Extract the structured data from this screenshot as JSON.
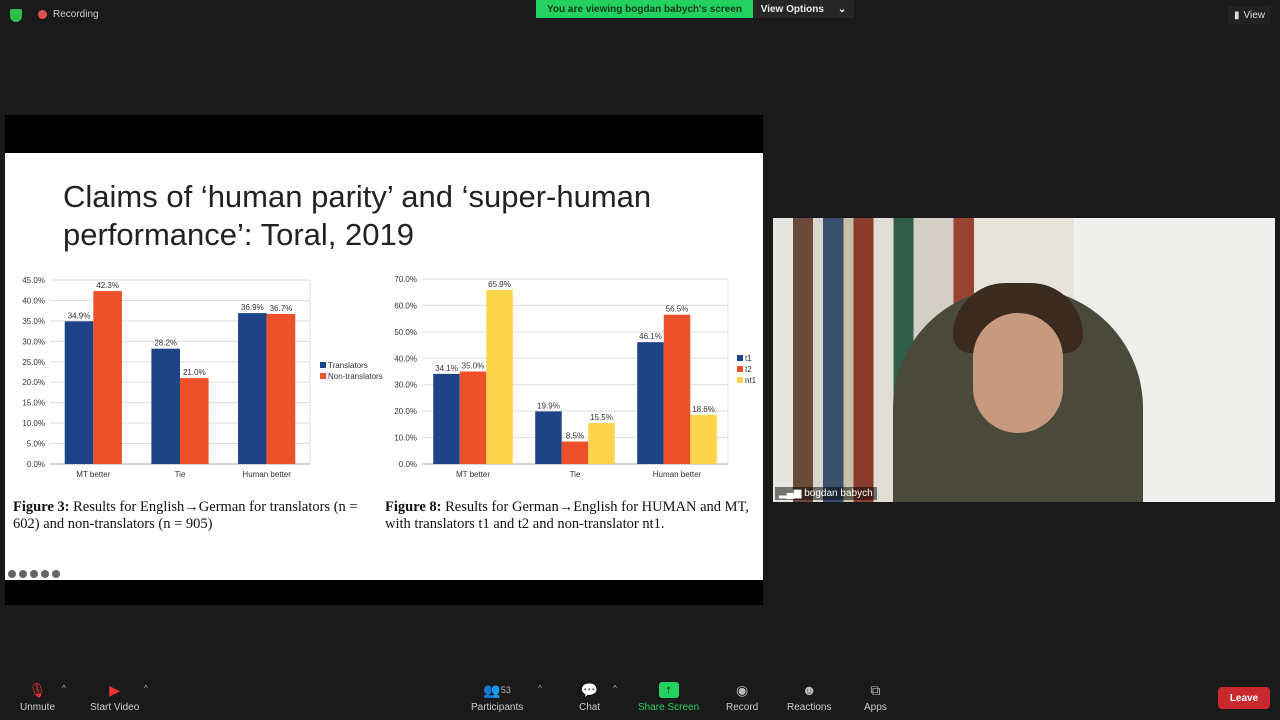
{
  "topbar": {
    "recording": "Recording",
    "banner": "You are viewing bogdan babych's screen",
    "view_options": "View Options",
    "view": "View"
  },
  "slide": {
    "title": "Claims of ‘human parity’ and ‘super-human performance’: Toral, 2019",
    "captions": [
      {
        "label": "Figure 3:",
        "text": " Results for English→German for translators (n = 602) and non-translators (n = 905)"
      },
      {
        "label": "Figure 8:",
        "text": " Results for German→English for HUMAN and MT, with translators t1 and t2 and non-translator nt1."
      }
    ]
  },
  "chart_data": [
    {
      "type": "bar",
      "categories": [
        "MT better",
        "Tie",
        "Human better"
      ],
      "ylim": [
        0,
        45
      ],
      "yticks": [
        "0.0%",
        "5.0%",
        "10.0%",
        "15.0%",
        "20.0%",
        "25.0%",
        "30.0%",
        "35.0%",
        "40.0%",
        "45.0%"
      ],
      "grid": true,
      "legend": "right",
      "series": [
        {
          "name": "Translators",
          "color": "#1f4387",
          "values": [
            34.9,
            28.2,
            36.9
          ],
          "labels": [
            "34.9%",
            "28.2%",
            "36.9%"
          ]
        },
        {
          "name": "Non-translators",
          "color": "#ee512a",
          "values": [
            42.3,
            21.0,
            36.7
          ],
          "labels": [
            "42.3%",
            "21.0%",
            "36.7%"
          ]
        }
      ]
    },
    {
      "type": "bar",
      "categories": [
        "MT better",
        "Tie",
        "Human better"
      ],
      "ylim": [
        0,
        70
      ],
      "yticks": [
        "0.0%",
        "10.0%",
        "20.0%",
        "30.0%",
        "40.0%",
        "50.0%",
        "60.0%",
        "70.0%"
      ],
      "grid": true,
      "legend": "right",
      "series": [
        {
          "name": "t1",
          "color": "#1f4387",
          "values": [
            34.1,
            19.9,
            46.1
          ],
          "labels": [
            "34.1%",
            "19.9%",
            "46.1%"
          ]
        },
        {
          "name": "t2",
          "color": "#ee512a",
          "values": [
            35.0,
            8.5,
            56.5
          ],
          "labels": [
            "35.0%",
            "8.5%",
            "56.5%"
          ]
        },
        {
          "name": "nt1",
          "color": "#fdd44a",
          "values": [
            65.9,
            15.5,
            18.6
          ],
          "labels": [
            "65.9%",
            "15.5%",
            "18.6%"
          ]
        }
      ]
    }
  ],
  "video": {
    "name": "bogdan babych"
  },
  "toolbar": {
    "unmute": "Unmute",
    "start_video": "Start Video",
    "participants": "Participants",
    "participants_count": "53",
    "chat": "Chat",
    "share_screen": "Share Screen",
    "record": "Record",
    "reactions": "Reactions",
    "apps": "Apps",
    "leave": "Leave"
  }
}
